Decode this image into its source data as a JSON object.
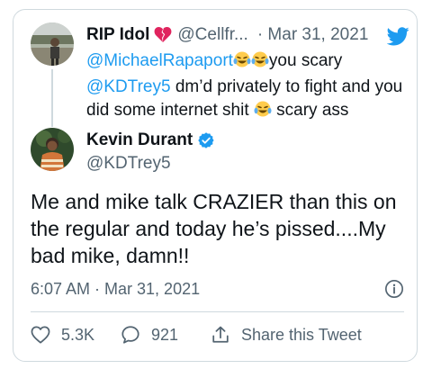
{
  "colors": {
    "accent": "#1d9bf0",
    "text": "#0f1419",
    "secondary": "#536471",
    "border": "#cfd9de",
    "broken_heart": "#e0245e"
  },
  "parent_tweet": {
    "author_name": "RIP Idol",
    "name_icon": "broken-heart-icon",
    "handle": "@Cellfr...",
    "separator": "·",
    "date": "Mar 31, 2021",
    "mention_1": "@MichaelRapaport",
    "emoji_1": "tears-of-joy-icon",
    "text_1": "you scary",
    "mention_2": "@KDTrey5",
    "text_2": " dm’d privately to fight and you did some internet shit ",
    "emoji_2": "tears-of-joy-icon",
    "text_3": " scary ass"
  },
  "main_tweet": {
    "author_name": "Kevin Durant",
    "verified_icon": "verified-badge-icon",
    "handle": "@KDTrey5",
    "text": "Me and mike talk CRAZIER than this on the regular and today he’s pissed....My bad mike, damn!!",
    "timestamp": "6:07 AM · Mar 31, 2021"
  },
  "actions": {
    "like_count": "5.3K",
    "reply_count": "921",
    "share_label": "Share this Tweet"
  },
  "icons": {
    "brand": "twitter-bird-icon",
    "info": "info-icon",
    "like": "heart-icon",
    "reply": "reply-bubble-icon",
    "share": "share-icon"
  }
}
